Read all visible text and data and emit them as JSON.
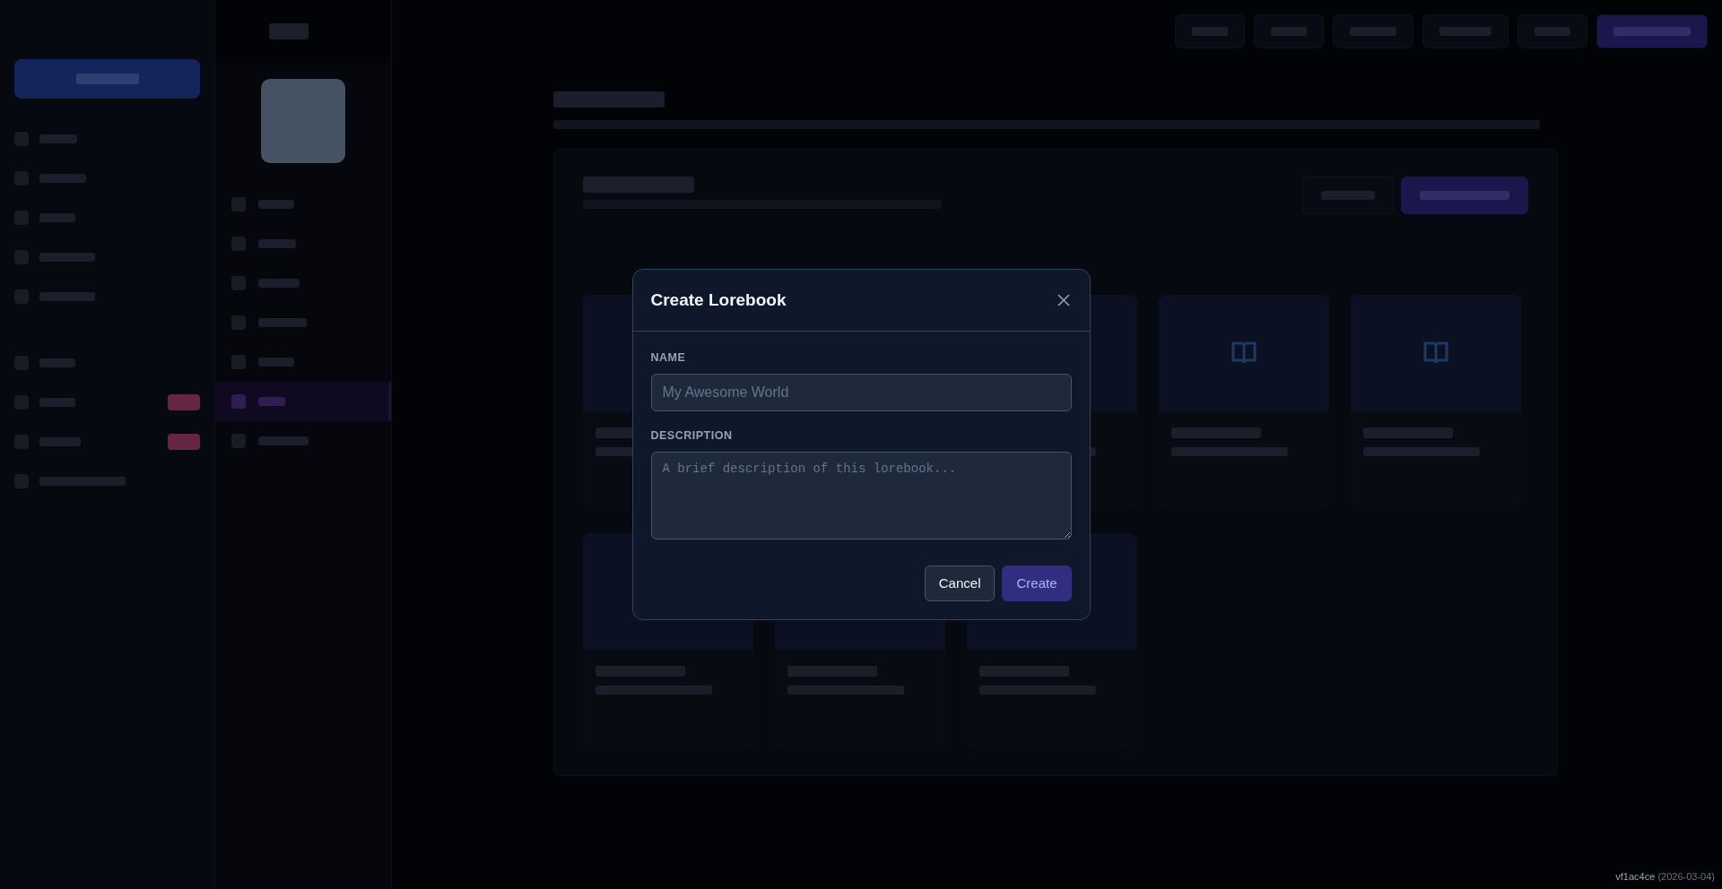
{
  "character_nav": [
    {
      "selected": false
    },
    {
      "selected": false
    },
    {
      "selected": false
    },
    {
      "selected": false
    },
    {
      "selected": false
    },
    {
      "selected": true
    },
    {
      "selected": false
    }
  ],
  "dialog": {
    "title": "Create Lorebook",
    "fields": [
      {
        "label": "NAME",
        "kind": "input",
        "placeholder": "My Awesome World"
      },
      {
        "label": "DESCRIPTION",
        "kind": "textarea",
        "placeholder": "A brief description of this lorebook..."
      }
    ],
    "buttons": [
      {
        "label": "Cancel",
        "kind": "secondary"
      },
      {
        "label": "Create",
        "kind": "primary"
      }
    ]
  },
  "version": {
    "hash": "vf1ac4ce",
    "date": "(2026-03-04)"
  }
}
